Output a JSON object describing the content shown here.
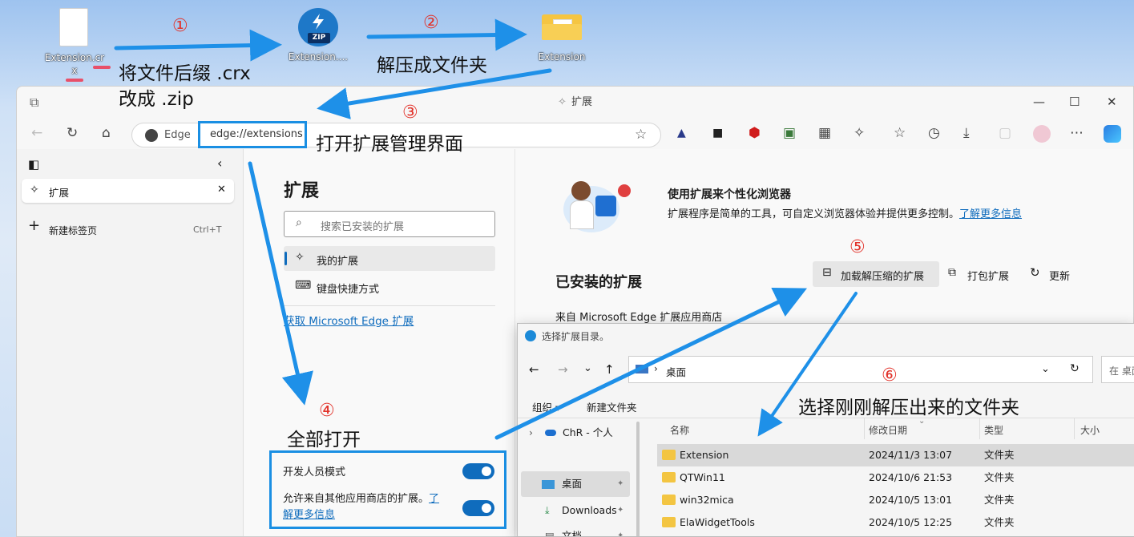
{
  "desktop": {
    "icon1_label_line1": "Extension.cr",
    "icon1_label_line2": "x",
    "zip_badge": "ZIP",
    "icon2_label": "Extension....",
    "icon3_label": "Extension"
  },
  "annotations": {
    "n1": "①",
    "n2": "②",
    "n3": "③",
    "n4": "④",
    "n5": "⑤",
    "n6": "⑥",
    "step1_line1": "将文件后缀 .crx",
    "step1_line2": "改成 .zip",
    "step2": "解压成文件夹",
    "step3": "打开扩展管理界面",
    "step4": "全部打开",
    "step6": "选择刚刚解压出来的文件夹"
  },
  "browser": {
    "window_title": "扩展",
    "brand": "Edge",
    "url": "edge://extensions",
    "sidebar": {
      "active_tab": "扩展",
      "new_tab": "新建标签页",
      "shortcut": "Ctrl+T"
    },
    "nav": {
      "heading": "扩展",
      "search_placeholder": "搜索已安装的扩展",
      "my_extensions": "我的扩展",
      "keyboard_shortcuts": "键盘快捷方式",
      "get_link": "获取 Microsoft Edge 扩展",
      "dev_mode": "开发人员模式",
      "allow_other_line1": "允许来自其他应用商店的扩展。",
      "allow_other_link1": "了",
      "allow_other_link2": "解更多信息",
      "dev_mode_on": true,
      "allow_other_on": true
    },
    "main": {
      "promo_title": "使用扩展来个性化浏览器",
      "promo_text": "扩展程序是简单的工具，可自定义浏览器体验并提供更多控制。",
      "promo_link": "了解更多信息",
      "installed_heading": "已安装的扩展",
      "load_unpacked": "加载解压缩的扩展",
      "pack": "打包扩展",
      "update": "更新",
      "from_store": "来自 Microsoft Edge 扩展应用商店"
    }
  },
  "dialog": {
    "title": "选择扩展目录。",
    "path": "桌面",
    "search_placeholder": "在 桌面",
    "organize": "组织",
    "new_folder": "新建文件夹",
    "tree": [
      "ChR - 个人",
      "桌面",
      "Downloads",
      "文档"
    ],
    "columns": [
      "名称",
      "修改日期",
      "类型",
      "大小"
    ],
    "rows": [
      {
        "name": "Extension",
        "date": "2024/11/3 13:07",
        "type": "文件夹"
      },
      {
        "name": "QTWin11",
        "date": "2024/10/6 21:53",
        "type": "文件夹"
      },
      {
        "name": "win32mica",
        "date": "2024/10/5 13:01",
        "type": "文件夹"
      },
      {
        "name": "ElaWidgetTools",
        "date": "2024/10/5 12:25",
        "type": "文件夹"
      }
    ]
  },
  "colors": {
    "accent": "#0f6cbd",
    "arrow": "#1e90e8",
    "annotation_number": "#e2322a",
    "highlight_box": "#1a8fe3"
  }
}
